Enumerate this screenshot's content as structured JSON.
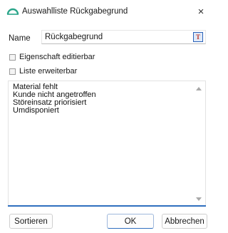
{
  "window": {
    "title": "Auswahlliste Rückgabegrund",
    "close_label": "×",
    "icon": "arc-icon",
    "accent_color": "#2aa58a"
  },
  "form": {
    "name_label": "Name",
    "name_value": "Rückgabegrund",
    "text_icon_label": "T",
    "checkbox_editable": {
      "label": "Eigenschaft editierbar",
      "checked": false
    },
    "checkbox_extendable": {
      "label": "Liste erweiterbar",
      "checked": false
    }
  },
  "list": {
    "items": [
      "Material fehlt",
      "Kunde nicht angetroffen",
      "Störeinsatz priorisiert",
      "Umdisponiert"
    ]
  },
  "buttons": {
    "sort_label": "Sortieren",
    "ok_label": "OK",
    "cancel_label": "Abbrechen"
  }
}
